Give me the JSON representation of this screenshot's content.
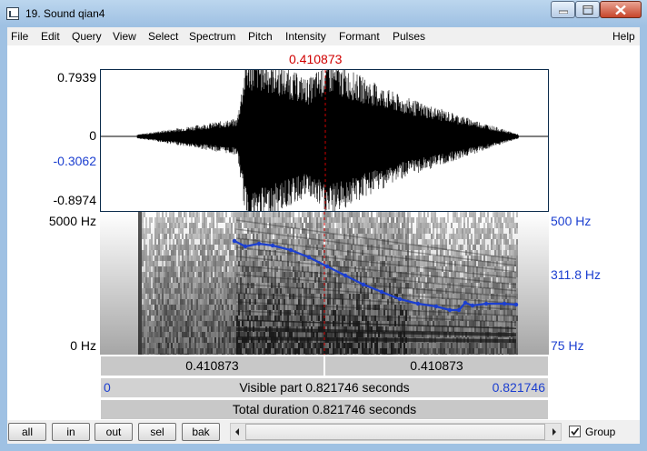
{
  "window": {
    "title": "19. Sound qian4"
  },
  "menu": [
    "File",
    "Edit",
    "Query",
    "View",
    "Select",
    "Spectrum",
    "Pitch",
    "Intensity",
    "Formant",
    "Pulses",
    "Help"
  ],
  "cursor": {
    "time_label": "0.410873",
    "color": "#d00000"
  },
  "waveform": {
    "amp_max": "0.7939",
    "amp_zero": "0",
    "amp_cursor": "-0.3062",
    "amp_min": "-0.8974"
  },
  "spectrogram": {
    "freq_top": "5000 Hz",
    "freq_bottom": "0 Hz",
    "pitch_top": "500 Hz",
    "pitch_mid": "311.8 Hz",
    "pitch_bottom": "75 Hz",
    "pitch_color": "#1c3fd0"
  },
  "selection": {
    "left_label": "0.410873",
    "right_label": "0.410873"
  },
  "visible": {
    "start": "0",
    "text": "Visible part 0.821746 seconds",
    "end": "0.821746"
  },
  "total": {
    "text": "Total duration 0.821746 seconds"
  },
  "buttons": {
    "all": "all",
    "in": "in",
    "out": "out",
    "sel": "sel",
    "bak": "bak"
  },
  "group": {
    "label": "Group",
    "checked": "✓"
  }
}
